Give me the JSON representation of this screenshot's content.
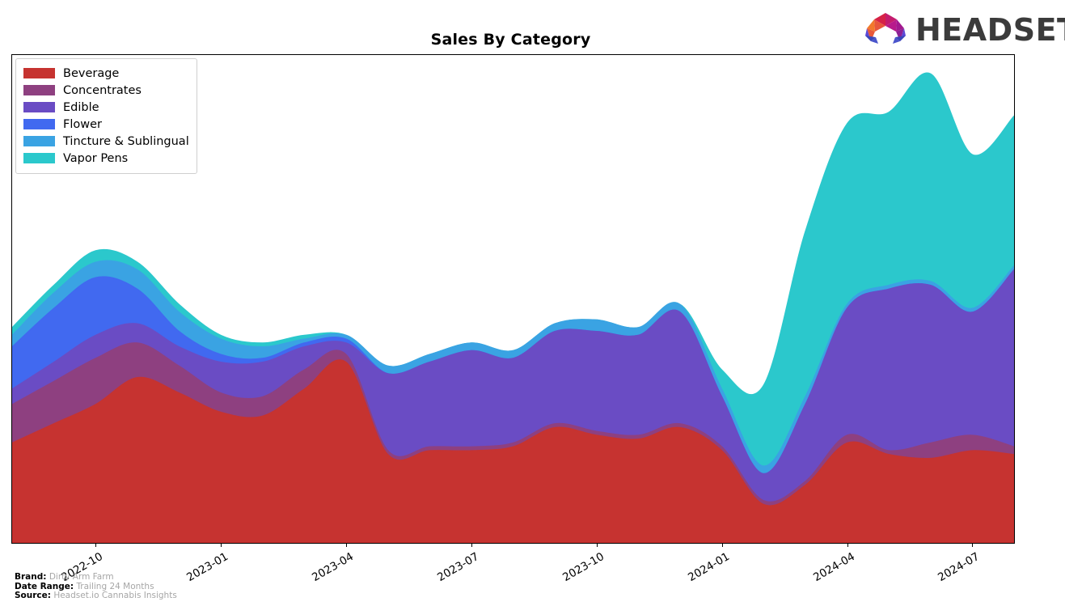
{
  "header": {
    "title": "Sales By Category",
    "logo_word": "HEADSET",
    "logo_icon": "headset-hexagon-logo"
  },
  "footer": {
    "rows": [
      {
        "key": "Brand:",
        "value": "Dirty Arm Farm"
      },
      {
        "key": "Date Range:",
        "value": "Trailing 24 Months"
      },
      {
        "key": "Source:",
        "value": "Headset.io Cannabis Insights"
      }
    ]
  },
  "legend": {
    "position": "upper-left",
    "entries": [
      {
        "label": "Beverage",
        "color": "#c63330"
      },
      {
        "label": "Concentrates",
        "color": "#8e4080"
      },
      {
        "label": "Edible",
        "color": "#6a4cc4"
      },
      {
        "label": "Flower",
        "color": "#4169f0"
      },
      {
        "label": "Tincture & Sublingual",
        "color": "#3aa3e3"
      },
      {
        "label": "Vapor Pens",
        "color": "#2bc8cc"
      }
    ]
  },
  "chart_data": {
    "type": "area",
    "stacked": true,
    "title": "Sales By Category",
    "xlabel": "",
    "ylabel": "",
    "grid": false,
    "legend_position": "upper left",
    "x": [
      "2022-08",
      "2022-09",
      "2022-10",
      "2022-11",
      "2022-12",
      "2023-01",
      "2023-02",
      "2023-03",
      "2023-04",
      "2023-05",
      "2023-06",
      "2023-07",
      "2023-08",
      "2023-09",
      "2023-10",
      "2023-11",
      "2023-12",
      "2024-01",
      "2024-02",
      "2024-03",
      "2024-04",
      "2024-05",
      "2024-06",
      "2024-07",
      "2024-08"
    ],
    "tick_labels": [
      "2022-10",
      "2023-01",
      "2023-04",
      "2023-07",
      "2023-10",
      "2024-01",
      "2024-04",
      "2024-07"
    ],
    "tick_positions": [
      2,
      5,
      8,
      11,
      14,
      17,
      20,
      23
    ],
    "ylim": [
      0,
      100
    ],
    "series": [
      {
        "name": "Beverage",
        "color": "#c63330",
        "values": [
          26,
          31,
          36,
          43,
          39,
          34,
          33,
          40,
          47,
          23,
          24,
          24,
          25,
          30,
          28,
          27,
          30,
          24,
          10,
          15,
          26,
          23,
          22,
          24,
          23
        ]
      },
      {
        "name": "Concentrates",
        "color": "#8e4080",
        "values": [
          10,
          11,
          12,
          9,
          7,
          5,
          5,
          5,
          2,
          1,
          1,
          1,
          1,
          1,
          1,
          1,
          1,
          1,
          1,
          1,
          2,
          1,
          4,
          4,
          2
        ]
      },
      {
        "name": "Edible",
        "color": "#6a4cc4",
        "values": [
          4,
          5,
          6,
          5,
          5,
          8,
          9,
          6,
          3,
          20,
          22,
          25,
          22,
          24,
          26,
          26,
          29,
          13,
          7,
          20,
          33,
          42,
          41,
          32,
          46
        ]
      },
      {
        "name": "Flower",
        "color": "#4169f0",
        "values": [
          11,
          14,
          15,
          9,
          4,
          2,
          1,
          1,
          1,
          0,
          0,
          0,
          0,
          0,
          0,
          0,
          0,
          0,
          0,
          0,
          0,
          0,
          0,
          0,
          0
        ]
      },
      {
        "name": "Tincture & Sublingual",
        "color": "#3aa3e3",
        "values": [
          3,
          4,
          4,
          5,
          5,
          4,
          3,
          1,
          1,
          2,
          2,
          2,
          2,
          2,
          3,
          2,
          2,
          2,
          2,
          2,
          1,
          1,
          1,
          1,
          1
        ]
      },
      {
        "name": "Vapor Pens",
        "color": "#2bc8cc",
        "values": [
          2,
          2,
          3,
          2,
          2,
          1,
          1,
          1,
          0,
          0,
          0,
          0,
          0,
          0,
          0,
          0,
          0,
          5,
          21,
          43,
          47,
          45,
          54,
          40,
          39
        ]
      }
    ]
  }
}
